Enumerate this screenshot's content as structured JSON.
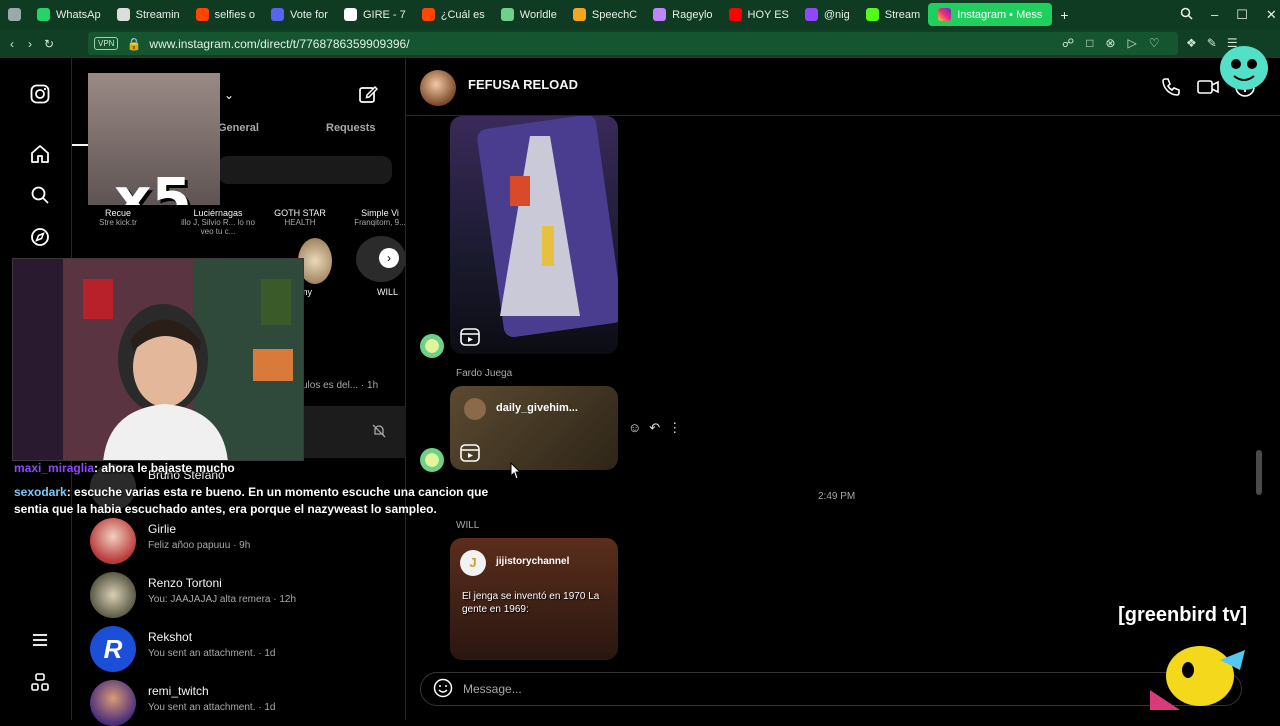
{
  "browser": {
    "tabs": [
      {
        "label": "",
        "icon": "window-icon",
        "color": "#9aa"
      },
      {
        "label": "WhatsAp",
        "icon": "whatsapp-icon",
        "color": "#25d366"
      },
      {
        "label": "Streamin",
        "icon": "star-icon",
        "color": "#dddddd"
      },
      {
        "label": "selfies o",
        "icon": "reddit-icon",
        "color": "#ff4500"
      },
      {
        "label": "Vote for",
        "icon": "discord-icon",
        "color": "#5865f2"
      },
      {
        "label": "GIRE - 7",
        "icon": "gire-icon",
        "color": "#ffffff"
      },
      {
        "label": "¿Cuál es",
        "icon": "reddit-icon",
        "color": "#ff4500"
      },
      {
        "label": "Worldle",
        "icon": "globe-icon",
        "color": "#6fd08a"
      },
      {
        "label": "SpeechC",
        "icon": "speech-icon",
        "color": "#f5a623"
      },
      {
        "label": "Rageylo",
        "icon": "rage-icon",
        "color": "#c084fc"
      },
      {
        "label": "HOY ES",
        "icon": "youtube-icon",
        "color": "#ff0000"
      },
      {
        "label": "@nig",
        "icon": "twitch-icon",
        "color": "#9146ff"
      },
      {
        "label": "Stream",
        "icon": "kick-icon",
        "color": "#53fc18"
      }
    ],
    "active_tab": {
      "label": "Instagram • Mess",
      "icon": "instagram-icon"
    },
    "new_tab_label": "+",
    "vpn_label": "VPN",
    "url": "www.instagram.com/direct/t/7768786359909396/"
  },
  "inbox": {
    "tabs": {
      "general": "General",
      "requests": "Requests"
    },
    "notes": [
      {
        "title": "Recue",
        "sub": "Stre kick.tr"
      },
      {
        "title": "Luciérnagas",
        "sub": "illo J, Silvio R... lo no veo tu c..."
      },
      {
        "title": "GOTH STAR",
        "sub": "HEALTH"
      },
      {
        "title": "Simple Vi",
        "sub": "Franqitom, 9..."
      }
    ],
    "notes_row2": [
      "my",
      "WILL"
    ],
    "partial_row": {
      "preview": "ulos es del... · 1h"
    },
    "conversations": [
      {
        "name": "Bruno Stefano",
        "preview": ""
      },
      {
        "name": "Girlie",
        "preview": "Feliz añoo papuuu · 9h"
      },
      {
        "name": "Renzo Tortoni",
        "preview": "You: JAAJAJAJ alta remera · 12h"
      },
      {
        "name": "Rekshot",
        "preview": "You sent an attachment. · 1d"
      },
      {
        "name": "remi_twitch",
        "preview": "You sent an attachment. · 1d"
      }
    ]
  },
  "chat": {
    "title": "FEFUSA RELOAD",
    "messages": [
      {
        "sender": "",
        "reel_label": ""
      },
      {
        "sender": "Fardo Juega",
        "reel_label": "daily_givehim..."
      },
      {
        "timestamp": "2:49 PM"
      },
      {
        "sender": "WILL",
        "reel_label": "jijistorychannel",
        "caption": "El jenga se inventó en 1970 La gente en 1969:"
      }
    ],
    "composer_placeholder": "Message..."
  },
  "stream_overlay": {
    "alert_text": "x5",
    "chat_lines": [
      {
        "user": "maxi_miraglia",
        "text": ": ahora le bajaste mucho"
      },
      {
        "user": "sexodark",
        "text": ": escuche varias esta re bueno. En un momento escuche una cancion que sentia que la habia escuchado antes, era porque el nazyweast lo sampleo."
      }
    ],
    "watermark": "[greenbird tv]"
  }
}
